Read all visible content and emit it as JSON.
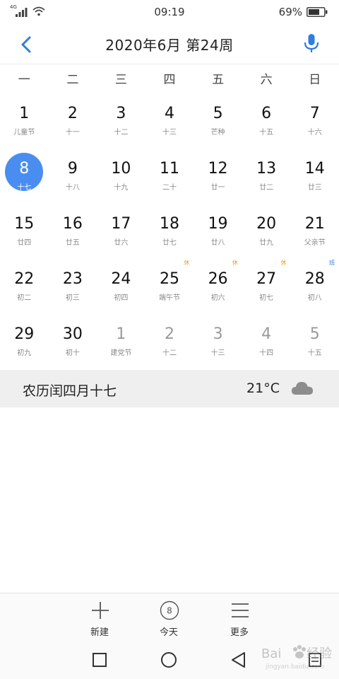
{
  "status_bar": {
    "network": "4G",
    "time": "09:19",
    "battery": "69%"
  },
  "header": {
    "title": "2020年6月  第24周"
  },
  "weekdays": [
    "一",
    "二",
    "三",
    "四",
    "五",
    "六",
    "日"
  ],
  "days": [
    {
      "num": "1",
      "sub": "儿童节"
    },
    {
      "num": "2",
      "sub": "十一"
    },
    {
      "num": "3",
      "sub": "十二"
    },
    {
      "num": "4",
      "sub": "十三"
    },
    {
      "num": "5",
      "sub": "芒种"
    },
    {
      "num": "6",
      "sub": "十五"
    },
    {
      "num": "7",
      "sub": "十六"
    },
    {
      "num": "8",
      "sub": "十七",
      "selected": true
    },
    {
      "num": "9",
      "sub": "十八"
    },
    {
      "num": "10",
      "sub": "十九"
    },
    {
      "num": "11",
      "sub": "二十"
    },
    {
      "num": "12",
      "sub": "廿一"
    },
    {
      "num": "13",
      "sub": "廿二"
    },
    {
      "num": "14",
      "sub": "廿三"
    },
    {
      "num": "15",
      "sub": "廿四"
    },
    {
      "num": "16",
      "sub": "廿五"
    },
    {
      "num": "17",
      "sub": "廿六"
    },
    {
      "num": "18",
      "sub": "廿七"
    },
    {
      "num": "19",
      "sub": "廿八"
    },
    {
      "num": "20",
      "sub": "廿九"
    },
    {
      "num": "21",
      "sub": "父亲节"
    },
    {
      "num": "22",
      "sub": "初二"
    },
    {
      "num": "23",
      "sub": "初三"
    },
    {
      "num": "24",
      "sub": "初四"
    },
    {
      "num": "25",
      "sub": "端午节",
      "badge": "休",
      "badge_type": "rest"
    },
    {
      "num": "26",
      "sub": "初六",
      "badge": "休",
      "badge_type": "rest"
    },
    {
      "num": "27",
      "sub": "初七",
      "badge": "休",
      "badge_type": "rest"
    },
    {
      "num": "28",
      "sub": "初八",
      "badge": "班",
      "badge_type": "work"
    },
    {
      "num": "29",
      "sub": "初九"
    },
    {
      "num": "30",
      "sub": "初十"
    },
    {
      "num": "1",
      "sub": "建党节",
      "muted": true
    },
    {
      "num": "2",
      "sub": "十二",
      "muted": true
    },
    {
      "num": "3",
      "sub": "十三",
      "muted": true
    },
    {
      "num": "4",
      "sub": "十四",
      "muted": true
    },
    {
      "num": "5",
      "sub": "十五",
      "muted": true
    }
  ],
  "lunar_bar": {
    "lunar_date": "农历闰四月十七",
    "temperature": "21°C",
    "weather_icon": "cloud-icon"
  },
  "toolbar": {
    "new_label": "新建",
    "today_label": "今天",
    "today_icon_num": "8",
    "more_label": "更多"
  },
  "watermark": {
    "text": "jingyan.baidu.com"
  },
  "colors": {
    "accent": "#4a8df0",
    "rest_badge": "#f19a1f",
    "work_badge": "#2f7de1",
    "muted_text": "#9a9a9a"
  }
}
